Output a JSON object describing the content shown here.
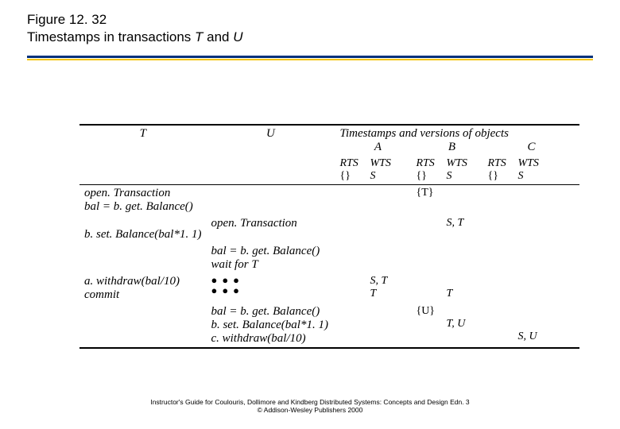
{
  "title": {
    "line1": "Figure 12. 32",
    "line2_a": "Timestamps in transactions ",
    "line2_T": "T",
    "line2_and": " and ",
    "line2_U": "U"
  },
  "headers": {
    "T": "T",
    "U": "U",
    "ts_caption": "Timestamps and versions of objects",
    "A": "A",
    "B": "B",
    "C": "C",
    "RTS": "RTS",
    "WTS": "WTS",
    "empty_set": "{}",
    "S": "S"
  },
  "rows": {
    "r1_T_a": "open. Transaction",
    "r1_T_b": "bal = b. get. Balance()",
    "r1_ts_B_RTS": "{T}",
    "r2_U": "open. Transaction",
    "r2_T": "b. set. Balance(bal*1. 1)",
    "r2_ts_B_WTS": "S, T",
    "r3_U_a": "bal = b. get. Balance()",
    "r3_U_b": "wait for T",
    "r4_T_a": "a. withdraw(bal/10)",
    "r4_T_b": "commit",
    "r4_ts_A_WTS_1": "S, T",
    "r4_ts_A_WTS_2": "T",
    "r4_ts_B_WTS": "T",
    "dots": "●●●",
    "r5_U_a": "bal = b. get. Balance()",
    "r5_ts_B_RTS": "{U}",
    "r5_U_b": "b. set. Balance(bal*1. 1)",
    "r5_ts_B_WTS": "T, U",
    "r5_U_c": "c. withdraw(bal/10)",
    "r5_ts_C_WTS": "S, U"
  },
  "footer": {
    "l1": "Instructor's Guide for  Coulouris, Dollimore and Kindberg   Distributed Systems: Concepts and Design   Edn. 3",
    "l2": "©  Addison-Wesley Publishers 2000"
  }
}
